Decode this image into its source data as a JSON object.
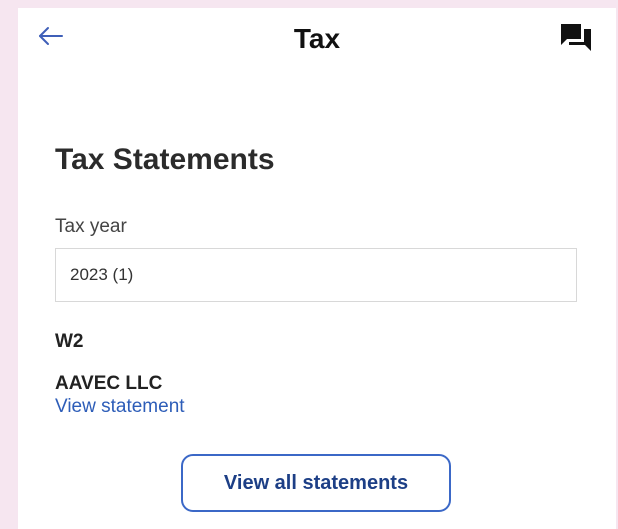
{
  "header": {
    "title": "Tax",
    "back_icon": "back-arrow-icon",
    "chat_icon": "chat-icon"
  },
  "main": {
    "section_title": "Tax Statements",
    "tax_year": {
      "label": "Tax year",
      "selected_value": "2023 (1)"
    },
    "statement": {
      "form_type": "W2",
      "employer": "AAVEC LLC",
      "link_label": "View statement"
    },
    "view_all_label": "View all statements"
  },
  "colors": {
    "background": "#f6e6f0",
    "link": "#2d5db8",
    "button_border": "#3b68c7",
    "button_text": "#1d3f86",
    "back_arrow": "#3f5fb8"
  }
}
